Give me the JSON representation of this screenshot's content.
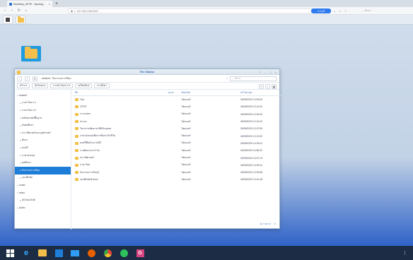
{
  "browser": {
    "tab_title": "Workshop_NCTE - Synolog...",
    "tab_close": "×",
    "new_tab": "+",
    "url": "192.168.5.168:5000",
    "search_pill": "การแก้",
    "search_placeholder": "ค้นหา"
  },
  "file_station": {
    "title": "File Station",
    "path_root": "student",
    "path_current": "กิจกรรมการเรียน",
    "search_placeholder": "ค้นหา",
    "toolbar": [
      "สร้าง ▾",
      "อัปโหลด ▾",
      "การดำเนินการ ▾",
      "เครื่องมือ ▾",
      "การตั้งค่า"
    ],
    "tree": [
      {
        "label": "student",
        "level": 0,
        "caret": "▾"
      },
      {
        "label": "ภาษาไทย ป.1",
        "level": 1,
        "caret": "▸"
      },
      {
        "label": "ภาษาไทย ป.2",
        "level": 1,
        "caret": "▸"
      },
      {
        "label": "คณิตศาสตร์พื้นฐาน",
        "level": 1,
        "caret": "▸"
      },
      {
        "label": "สังคมศึกษา",
        "level": 1,
        "caret": "▸"
      },
      {
        "label": "ประวัติศาสตร์และภูมิศาสตร์",
        "level": 1,
        "caret": "▸"
      },
      {
        "label": "ศิลปะ",
        "level": 1,
        "caret": "▸"
      },
      {
        "label": "ดนตรี",
        "level": 1,
        "caret": "▸"
      },
      {
        "label": "ภาษาอังกฤษ",
        "level": 1,
        "caret": "▸"
      },
      {
        "label": "พลศึกษา",
        "level": 1,
        "caret": "▸"
      },
      {
        "label": "กิจกรรมการเรียน",
        "level": 1,
        "caret": "▸",
        "selected": true
      },
      {
        "label": "แบบฝึกหัด",
        "level": 1,
        "caret": "▸"
      },
      {
        "label": "music",
        "level": 0,
        "caret": "▸"
      },
      {
        "label": "video",
        "level": 0,
        "caret": "▾"
      },
      {
        "label": "อัปโหลดไฟล์",
        "level": 1,
        "caret": "▸"
      },
      {
        "label": "photo",
        "level": 0,
        "caret": "▸"
      }
    ],
    "columns": {
      "name": "ชื่อ",
      "size": "ขนาด",
      "type": "ชนิดไฟล์",
      "modified": "แก้ไขล่าสุด"
    },
    "files": [
      {
        "name": "ไทย",
        "type": "โฟลเดอร์",
        "modified": "26/09/2020 12:09:00"
      },
      {
        "name": "OTOP",
        "type": "โฟลเดอร์",
        "modified": "26/09/2020 12:14:32"
      },
      {
        "name": "การเกษตร",
        "type": "โฟลเดอร์",
        "modified": "26/09/2020 12:09:40"
      },
      {
        "name": "ประมง",
        "type": "โฟลเดอร์",
        "modified": "26/09/2020 12:14:22"
      },
      {
        "name": "โครงการพัฒนาอาชีพในชุมชน",
        "type": "โฟลเดอร์",
        "modified": "26/09/2020 12:07:50"
      },
      {
        "name": "ภาษาอังกฤษเพื่อการสื่อสารในชีวิต",
        "type": "โฟลเดอร์",
        "modified": "26/09/2020 12:13:32"
      },
      {
        "name": "ดนตรีพื้นบ้านภาคใต้",
        "type": "โฟลเดอร์",
        "modified": "26/09/2020 14:09:01"
      },
      {
        "name": "งานศิลปะประจำวัน",
        "type": "โฟลเดอร์",
        "modified": "26/09/2020 11:58:32"
      },
      {
        "name": "ประวัติศาสตร์",
        "type": "โฟลเดอร์",
        "modified": "26/09/2020 14:07:13"
      },
      {
        "name": "ภาษาไทย",
        "type": "โฟลเดอร์",
        "modified": "26/09/2020 14:09:41"
      },
      {
        "name": "กิจกรรมการเรียนรู้",
        "type": "โฟลเดอร์",
        "modified": "26/09/2020 12:09:58"
      },
      {
        "name": "แบบฝึกหัดท้ายบท",
        "type": "โฟลเดอร์",
        "modified": "26/09/2020 12:41:26"
      }
    ],
    "status_items": "11 รายการ"
  }
}
